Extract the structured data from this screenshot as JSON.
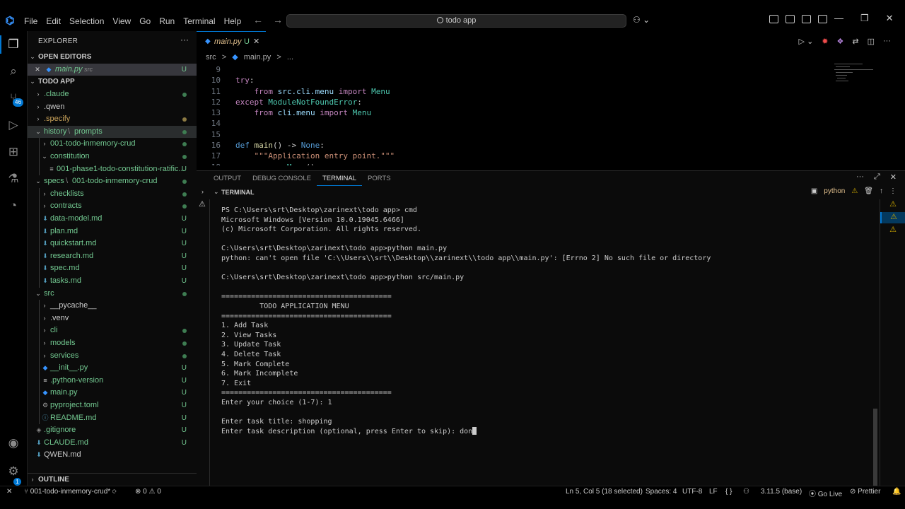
{
  "titlebar": {
    "menu": [
      "File",
      "Edit",
      "Selection",
      "View",
      "Go",
      "Run",
      "Terminal",
      "Help"
    ],
    "search_text": "todo app"
  },
  "activity_bar": {
    "scm_badge": "46",
    "settings_badge": "1"
  },
  "sidebar": {
    "title": "EXPLORER",
    "open_editors_label": "OPEN EDITORS",
    "open_editor": {
      "name": "main.py",
      "folder": "src",
      "status": "U"
    },
    "root_label": "TODO APP",
    "outline_label": "OUTLINE",
    "tree": [
      {
        "name": ".claude",
        "status": "dot"
      },
      {
        "name": ".qwen",
        "status": ""
      },
      {
        "name": ".specify",
        "status": "dot-yellow"
      },
      {
        "name": "history",
        "sub": "prompts",
        "status": "dot"
      },
      {
        "name": "001-todo-inmemory-crud",
        "status": "dot"
      },
      {
        "name": "constitution",
        "status": "dot"
      },
      {
        "name": "001-phase1-todo-constitution-ratific...",
        "status": "U"
      },
      {
        "name": "specs",
        "sub": "001-todo-inmemory-crud",
        "status": "dot"
      },
      {
        "name": "checklists",
        "status": "dot"
      },
      {
        "name": "contracts",
        "status": "dot"
      },
      {
        "name": "data-model.md",
        "status": "U"
      },
      {
        "name": "plan.md",
        "status": "U"
      },
      {
        "name": "quickstart.md",
        "status": "U"
      },
      {
        "name": "research.md",
        "status": "U"
      },
      {
        "name": "spec.md",
        "status": "U"
      },
      {
        "name": "tasks.md",
        "status": "U"
      },
      {
        "name": "src",
        "status": "dot"
      },
      {
        "name": "__pycache__",
        "status": ""
      },
      {
        "name": ".venv",
        "status": ""
      },
      {
        "name": "cli",
        "status": "dot"
      },
      {
        "name": "models",
        "status": "dot"
      },
      {
        "name": "services",
        "status": "dot"
      },
      {
        "name": "__init__.py",
        "status": "U"
      },
      {
        "name": ".python-version",
        "status": "U"
      },
      {
        "name": "main.py",
        "status": "U"
      },
      {
        "name": "pyproject.toml",
        "status": "U"
      },
      {
        "name": "README.md",
        "status": "U"
      },
      {
        "name": ".gitignore",
        "status": "U"
      },
      {
        "name": "CLAUDE.md",
        "status": "U"
      },
      {
        "name": "QWEN.md",
        "status": ""
      }
    ]
  },
  "editor": {
    "tab": {
      "name": "main.py",
      "status": "U"
    },
    "breadcrumbs": [
      "src",
      ">",
      "main.py",
      ">",
      "..."
    ],
    "lines": [
      {
        "n": "9",
        "text": ""
      },
      {
        "n": "10",
        "text": "try:"
      },
      {
        "n": "11",
        "text": "    from src.cli.menu import Menu"
      },
      {
        "n": "12",
        "text": "except ModuleNotFoundError:"
      },
      {
        "n": "13",
        "text": "    from cli.menu import Menu"
      },
      {
        "n": "14",
        "text": ""
      },
      {
        "n": "15",
        "text": ""
      },
      {
        "n": "16",
        "text": "def main() -> None:"
      },
      {
        "n": "17",
        "text": "    \"\"\"Application entry point.\"\"\""
      },
      {
        "n": "18",
        "text": "    menu = Menu()"
      }
    ]
  },
  "panel": {
    "tabs": [
      "OUTPUT",
      "DEBUG CONSOLE",
      "TERMINAL",
      "PORTS"
    ],
    "active_tab": "TERMINAL",
    "terminal_label": "TERMINAL",
    "terminal_name": "python",
    "output": [
      "PS C:\\Users\\srt\\Desktop\\zarinext\\todo app> cmd",
      "Microsoft Windows [Version 10.0.19045.6466]",
      "(c) Microsoft Corporation. All rights reserved.",
      "",
      "C:\\Users\\srt\\Desktop\\zarinext\\todo app>python main.py",
      "python: can't open file 'C:\\\\Users\\\\srt\\\\Desktop\\\\zarinext\\\\todo app\\\\main.py': [Errno 2] No such file or directory",
      "",
      "C:\\Users\\srt\\Desktop\\zarinext\\todo app>python src/main.py",
      "",
      "========================================",
      "         TODO APPLICATION MENU",
      "========================================",
      "1. Add Task",
      "2. View Tasks",
      "3. Update Task",
      "4. Delete Task",
      "5. Mark Complete",
      "6. Mark Incomplete",
      "7. Exit",
      "========================================",
      "Enter your choice (1-7): 1",
      "",
      "Enter task title: shopping",
      "Enter task description (optional, press Enter to skip): don"
    ]
  },
  "statusbar": {
    "branch": "001-todo-inmemory-crud*",
    "errors": "0",
    "warnings": "0",
    "position": "Ln 5, Col 5 (18 selected)",
    "spaces": "Spaces: 4",
    "encoding": "UTF-8",
    "eol": "LF",
    "language_braces": "{ }",
    "python_version": "3.11.5 (base)",
    "go_live": "Go Live",
    "prettier": "Prettier"
  }
}
